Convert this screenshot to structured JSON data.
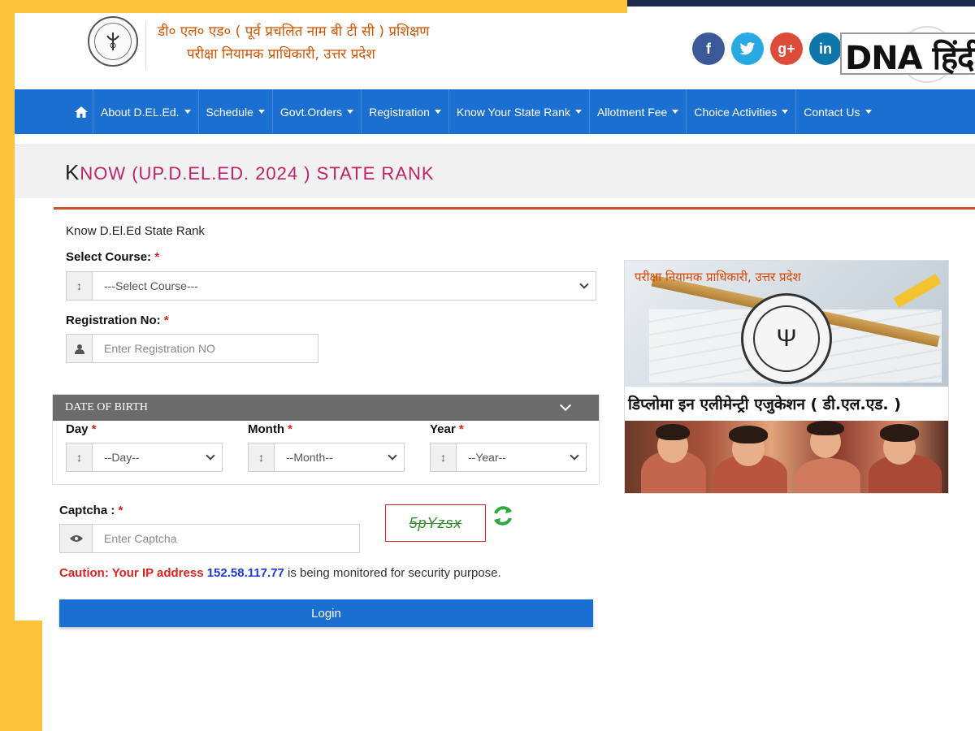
{
  "header": {
    "title_line1": "डी० एल० एड० ( पूर्व प्रचलित नाम बी टी सी ) प्रशिक्षण",
    "title_line2": "परीक्षा नियामक प्राधिकारी, उत्तर प्रदेश",
    "social": [
      "facebook-icon",
      "twitter-icon",
      "google-plus-icon",
      "linkedin-icon"
    ],
    "watermark": "DNA हिंदी"
  },
  "nav": {
    "home_icon": "home-icon",
    "items": [
      "About D.EL.Ed.",
      "Schedule",
      "Govt.Orders",
      "Registration",
      "Know Your State Rank",
      "Allotment Fee",
      "Choice Activities",
      "Contact Us"
    ]
  },
  "page": {
    "title_first": "K",
    "title_rest": "NOW (UP.D.EL.ED. 2024 ) STATE RANK"
  },
  "form": {
    "subtitle": "Know D.El.Ed State Rank",
    "course_label": "Select Course:",
    "course_value": "---Select Course---",
    "reg_label": "Registration No:",
    "reg_placeholder": "Enter Registration NO",
    "dob_header": "DATE OF BIRTH",
    "day_label": "Day",
    "day_value": "--Day--",
    "month_label": "Month",
    "month_value": "--Month--",
    "year_label": "Year",
    "year_value": "--Year--",
    "captcha_label": "Captcha :",
    "captcha_placeholder": "Enter Captcha",
    "captcha_text": "5pYzsx",
    "required_mark": "*",
    "caution_prefix": "Caution: Your IP address",
    "ip": "152.58.117.77",
    "caution_suffix": "is being monitored for security purpose.",
    "login_label": "Login"
  },
  "promo": {
    "caption_top": "परीक्षा नियामक प्राधिकारी, उत्तर प्रदेश",
    "caption_band": "डिप्लोमा इन एलीमेन्ट्री एजुकेशन ( डी.एल.एड. )"
  },
  "colors": {
    "nav": "#1b6fd1",
    "accent_title": "#c0226a",
    "frame": "#fbc43a",
    "caution": "#e02020",
    "ip": "#1a3bd6"
  }
}
